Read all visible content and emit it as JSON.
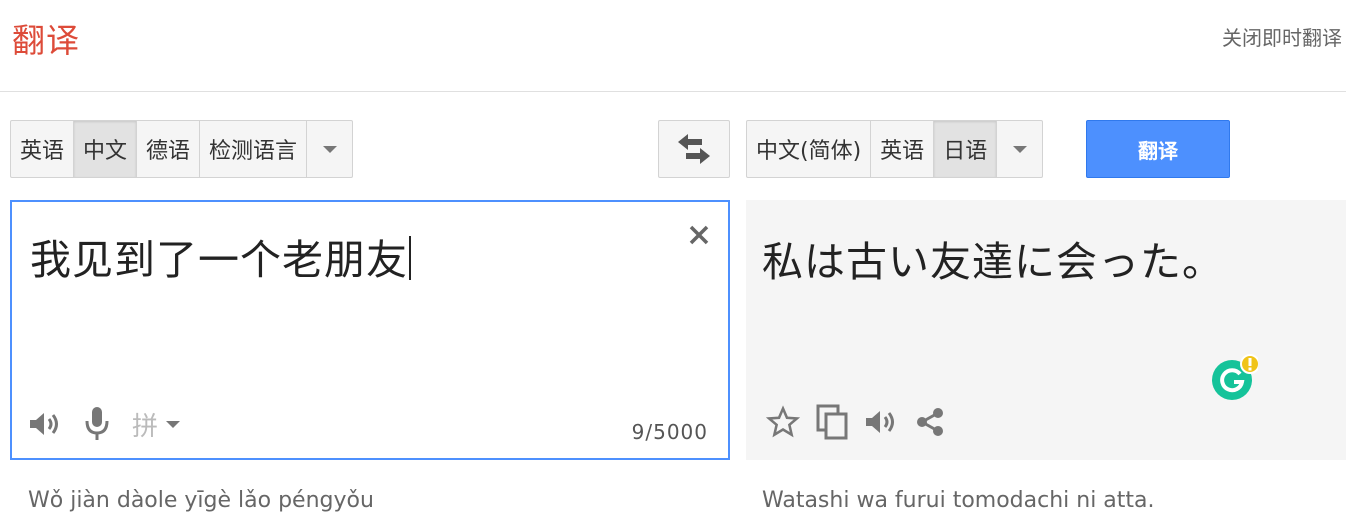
{
  "header": {
    "logo_text": "翻译",
    "instant_toggle_label": "关闭即时翻译"
  },
  "source_languages": {
    "buttons": [
      "英语",
      "中文",
      "德语",
      "检测语言"
    ],
    "selected": "中文"
  },
  "target_languages": {
    "buttons": [
      "中文(简体)",
      "英语",
      "日语"
    ],
    "selected": "日语"
  },
  "translate_button_label": "翻译",
  "source": {
    "text": "我见到了一个老朋友",
    "ime_label": "拼",
    "char_count": "9/5000",
    "transliteration": "Wǒ jiàn dàole yīgè lǎo péngyǒu"
  },
  "result": {
    "text": "私は古い友達に会った。",
    "transliteration": "Watashi wa furui tomodachi ni atta."
  },
  "icons": [
    "speaker-icon",
    "microphone-icon",
    "clear-icon",
    "swap-icon",
    "star-icon",
    "copy-icon",
    "share-icon",
    "grammarly-icon"
  ],
  "colors": {
    "logo": "#dd4b39",
    "translate_button": "#4d90fe",
    "source_border": "#4d90fe",
    "result_background": "#f5f5f5",
    "grammarly_green": "#15c39a",
    "grammarly_alert": "#f0c419"
  }
}
